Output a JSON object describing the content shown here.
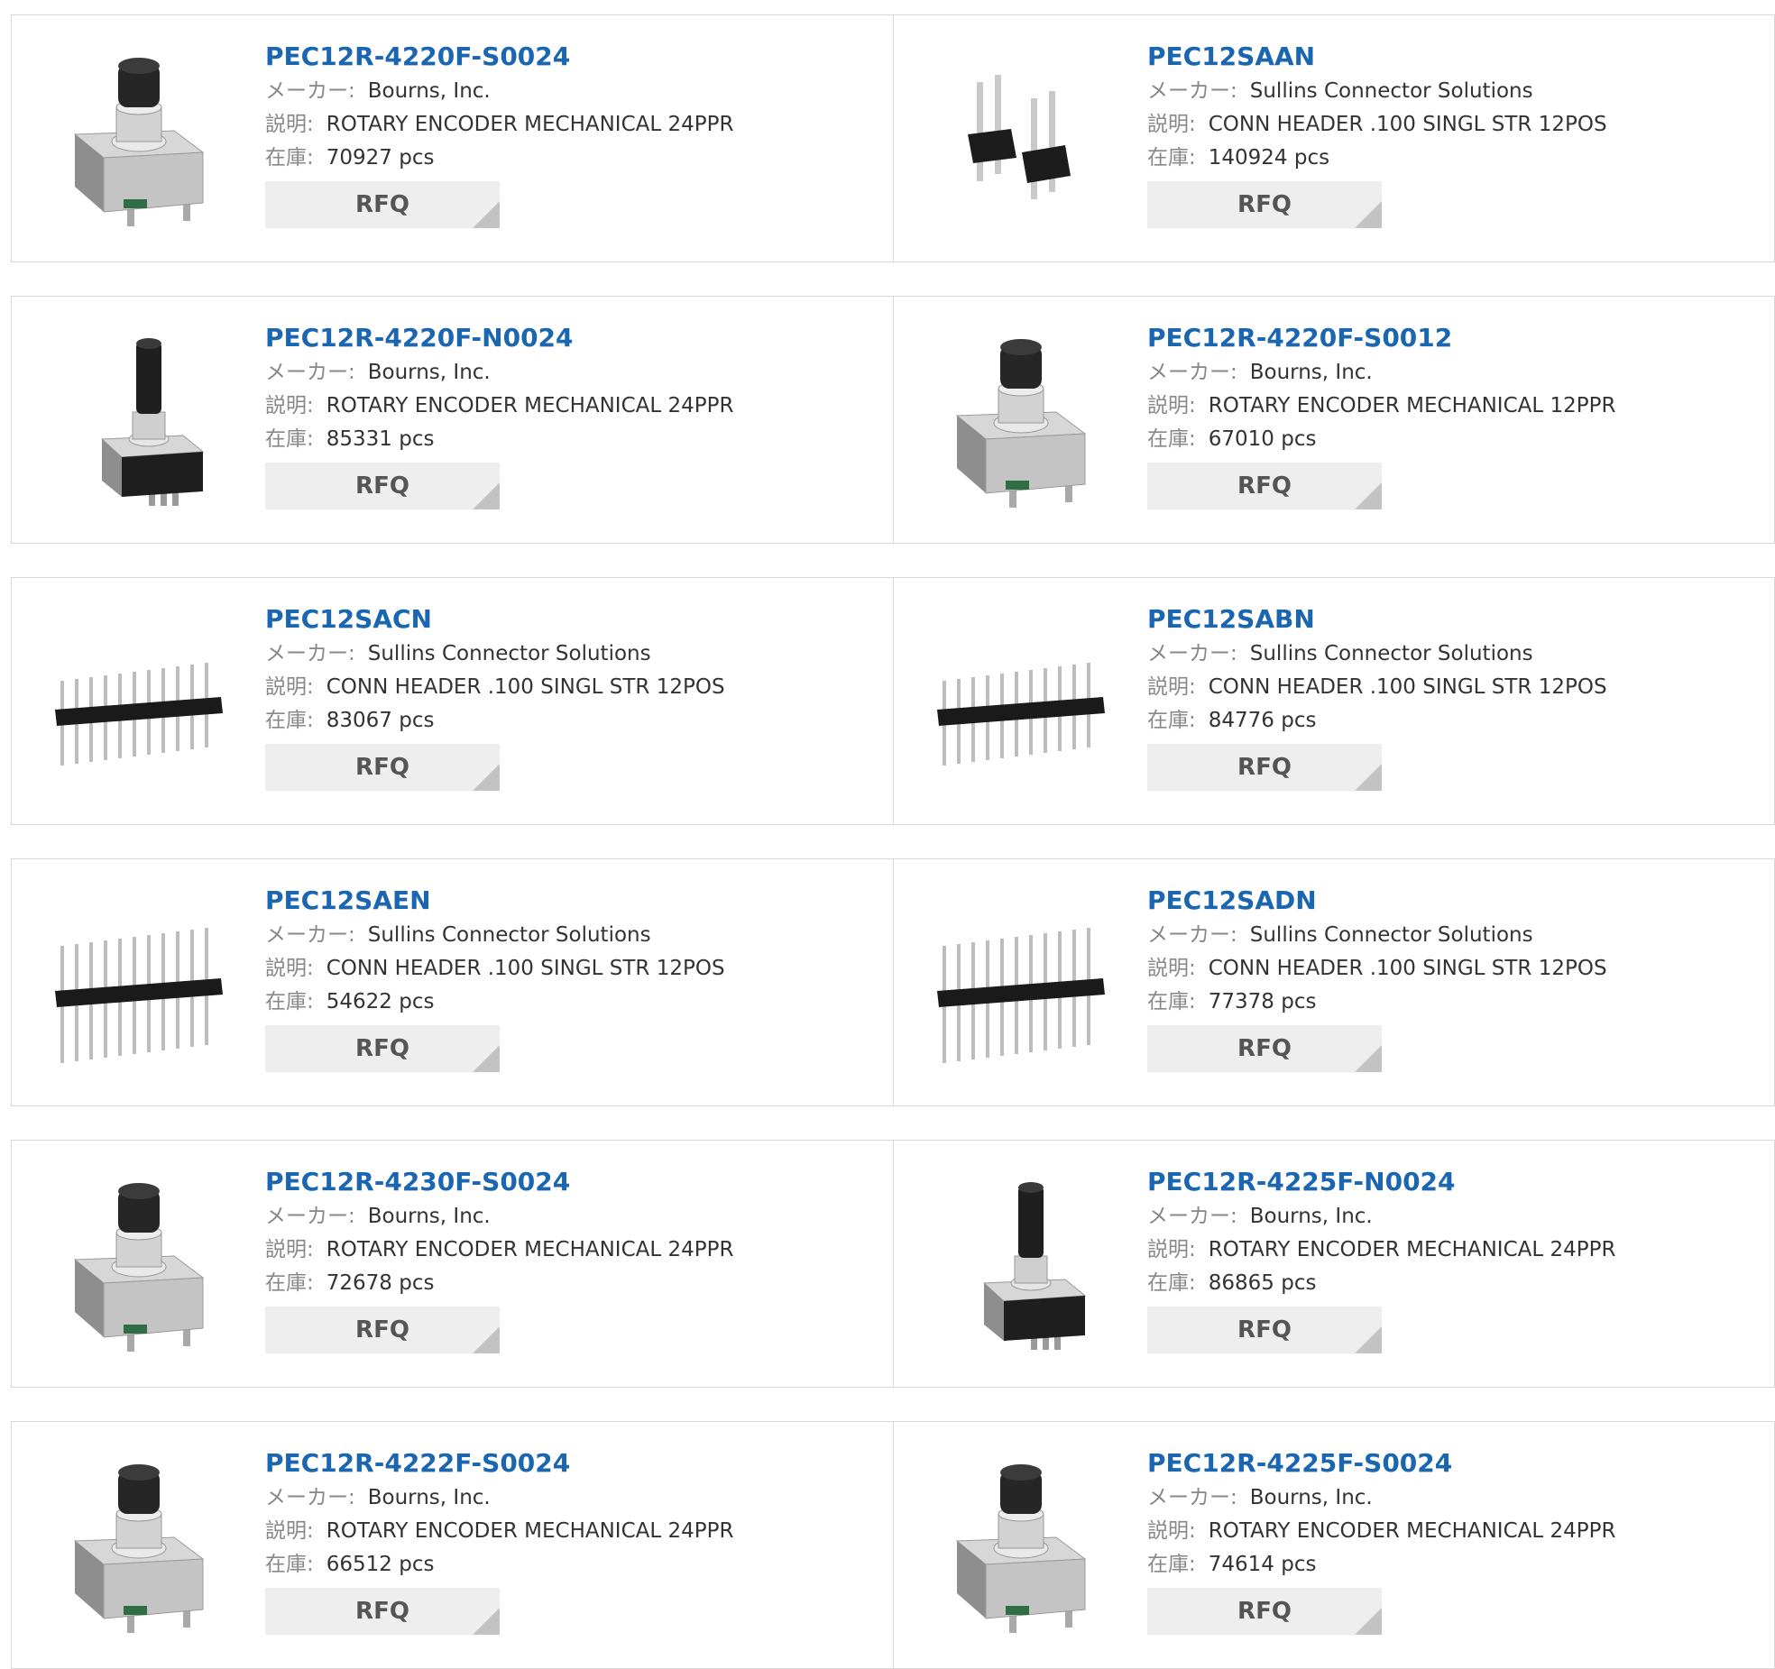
{
  "labels": {
    "maker": "メーカー:",
    "desc": "説明:",
    "stock": "在庫:",
    "rfq": "RFQ"
  },
  "products": [
    {
      "part": "PEC12R-4220F-S0024",
      "maker": "Bourns, Inc.",
      "desc": "ROTARY ENCODER MECHANICAL 24PPR",
      "stock": "70927 pcs",
      "image": "rotary-encoder-icon"
    },
    {
      "part": "PEC12SAAN",
      "maker": "Sullins Connector Solutions",
      "desc": "CONN HEADER .100 SINGL STR 12POS",
      "stock": "140924 pcs",
      "image": "pin-header-short-icon"
    },
    {
      "part": "PEC12R-4220F-N0024",
      "maker": "Bourns, Inc.",
      "desc": "ROTARY ENCODER MECHANICAL 24PPR",
      "stock": "85331 pcs",
      "image": "rotary-encoder-tall-icon"
    },
    {
      "part": "PEC12R-4220F-S0012",
      "maker": "Bourns, Inc.",
      "desc": "ROTARY ENCODER MECHANICAL 12PPR",
      "stock": "67010 pcs",
      "image": "rotary-encoder-icon"
    },
    {
      "part": "PEC12SACN",
      "maker": "Sullins Connector Solutions",
      "desc": "CONN HEADER .100 SINGL STR 12POS",
      "stock": "83067 pcs",
      "image": "pin-header-icon"
    },
    {
      "part": "PEC12SABN",
      "maker": "Sullins Connector Solutions",
      "desc": "CONN HEADER .100 SINGL STR 12POS",
      "stock": "84776 pcs",
      "image": "pin-header-icon"
    },
    {
      "part": "PEC12SAEN",
      "maker": "Sullins Connector Solutions",
      "desc": "CONN HEADER .100 SINGL STR 12POS",
      "stock": "54622 pcs",
      "image": "pin-header-long-icon"
    },
    {
      "part": "PEC12SADN",
      "maker": "Sullins Connector Solutions",
      "desc": "CONN HEADER .100 SINGL STR 12POS",
      "stock": "77378 pcs",
      "image": "pin-header-long-icon"
    },
    {
      "part": "PEC12R-4230F-S0024",
      "maker": "Bourns, Inc.",
      "desc": "ROTARY ENCODER MECHANICAL 24PPR",
      "stock": "72678 pcs",
      "image": "rotary-encoder-icon"
    },
    {
      "part": "PEC12R-4225F-N0024",
      "maker": "Bourns, Inc.",
      "desc": "ROTARY ENCODER MECHANICAL 24PPR",
      "stock": "86865 pcs",
      "image": "rotary-encoder-tall-icon"
    },
    {
      "part": "PEC12R-4222F-S0024",
      "maker": "Bourns, Inc.",
      "desc": "ROTARY ENCODER MECHANICAL 24PPR",
      "stock": "66512 pcs",
      "image": "rotary-encoder-icon"
    },
    {
      "part": "PEC12R-4225F-S0024",
      "maker": "Bourns, Inc.",
      "desc": "ROTARY ENCODER MECHANICAL 24PPR",
      "stock": "74614 pcs",
      "image": "rotary-encoder-icon"
    }
  ]
}
